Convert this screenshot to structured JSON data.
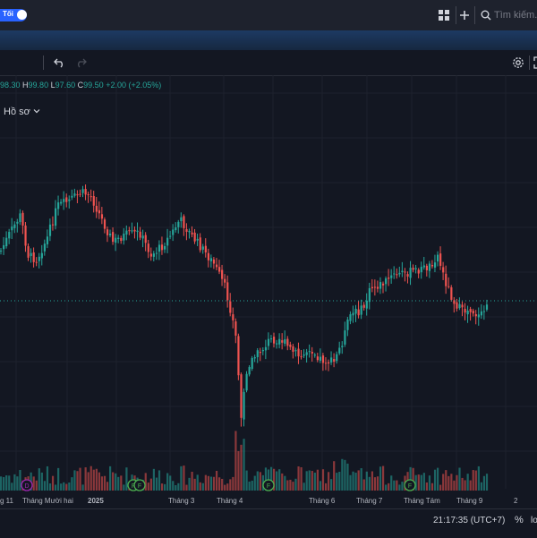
{
  "topbar": {
    "theme_label": "Tối",
    "search_placeholder": "Tìm kiếm..."
  },
  "toolbar": {
    "profile_label": "Hồ sơ"
  },
  "legend": {
    "o_value": "98.30",
    "h_label": "H",
    "h_value": "99.80",
    "l_label": "L",
    "l_value": "97.60",
    "c_label": "C",
    "c_value": "99.50",
    "change": "+2.00 (+2.05%)"
  },
  "chart_data": {
    "type": "candlestick",
    "current_price_line": 99.5,
    "x_labels": [
      "g 11",
      "Tháng Mười hai",
      "2025",
      "Tháng 3",
      "Tháng 4",
      "Tháng 6",
      "Tháng 7",
      "Tháng Tám",
      "Tháng 9",
      "2"
    ],
    "markers": [
      {
        "label": "D",
        "color": "#9c27b0"
      },
      {
        "label": "F",
        "color": "#4caf50"
      },
      {
        "label": "F",
        "color": "#4caf50"
      },
      {
        "label": "F",
        "color": "#4caf50"
      },
      {
        "label": "F",
        "color": "#4caf50"
      }
    ]
  },
  "bottombar": {
    "clock": "21:17:35 (UTC+7)",
    "percent": "%",
    "log": "lo"
  },
  "colors": {
    "up": "#26a69a",
    "down": "#ef5350",
    "bg": "#131722"
  }
}
